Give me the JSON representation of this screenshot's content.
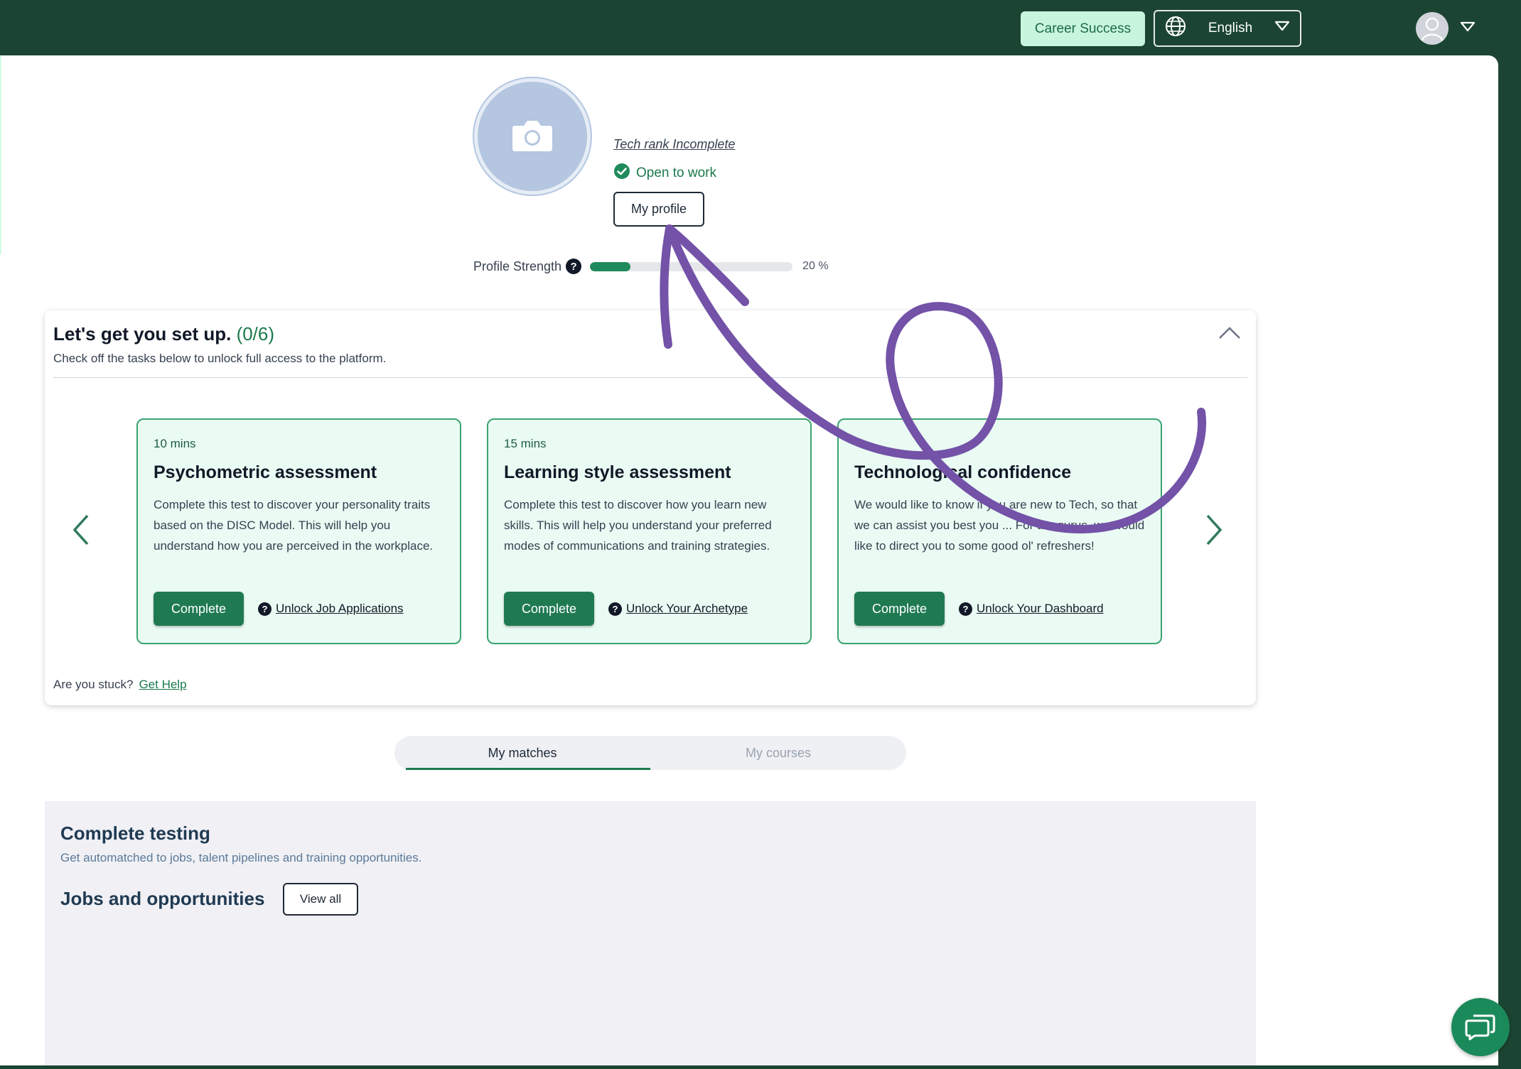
{
  "header": {
    "career_button": "Career Success",
    "language": "English",
    "icons": {
      "globe": "globe-icon",
      "caret": "caret-down-icon",
      "avatar": "user-avatar-icon"
    }
  },
  "profile": {
    "tech_rank": "Tech rank Incomplete",
    "status": "Open to work",
    "my_profile_button": "My profile",
    "strength_label": "Profile Strength",
    "strength_help": "?",
    "strength_percent_text": "20 %",
    "strength_value": 0.2
  },
  "setup": {
    "title": "Let's get you set up.",
    "count": "(0/6)",
    "subtitle": "Check off the tasks below to unlock full access to the platform.",
    "cards": [
      {
        "time": "10 mins",
        "title": "Psychometric assessment",
        "description": "Complete this test to discover your personality traits based on the DISC Model. This will help you understand how you are perceived in the workplace.",
        "button": "Complete",
        "unlock": "Unlock Job Applications"
      },
      {
        "time": "15 mins",
        "title": "Learning style assessment",
        "description": "Complete this test to discover how you learn new skills. This will help you understand your preferred modes of communications and training strategies.",
        "button": "Complete",
        "unlock": "Unlock Your Archetype"
      },
      {
        "time": "",
        "title": "Technological confidence",
        "description": "We would like to know if you are new to Tech, so that we can assist you best you ... For the gurus, we would like to direct you to some good ol' refreshers!",
        "button": "Complete",
        "unlock": "Unlock Your Dashboard"
      }
    ],
    "stuck_text": "Are you stuck?",
    "help_link": "Get Help"
  },
  "tabs": [
    {
      "label": "My matches",
      "active": true
    },
    {
      "label": "My courses",
      "active": false
    }
  ],
  "testing": {
    "title": "Complete testing",
    "subtitle": "Get automatched to jobs, talent pipelines and training opportunities.",
    "jobs_title": "Jobs and opportunities",
    "view_all": "View all"
  },
  "colors": {
    "brand_dark": "#1b4532",
    "accent": "#1f7a52",
    "annotation": "#7352a8"
  }
}
